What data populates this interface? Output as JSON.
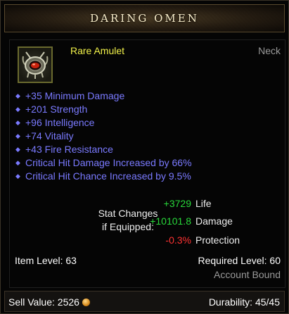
{
  "item": {
    "name": "DARING OMEN",
    "type": "Rare Amulet",
    "slot": "Neck"
  },
  "affixes": [
    "+35 Minimum Damage",
    "+201 Strength",
    "+96 Intelligence",
    "+74 Vitality",
    "+43 Fire Resistance",
    "Critical Hit Damage Increased by 66%",
    "Critical Hit Chance Increased by 9.5%"
  ],
  "stat_changes": {
    "label_line1": "Stat Changes",
    "label_line2": "if Equipped:",
    "rows": [
      {
        "value": "+3729",
        "name": "Life",
        "color": "#28d83a"
      },
      {
        "value": "+10101.8",
        "name": "Damage",
        "color": "#28d83a"
      },
      {
        "value": "-0.3%",
        "name": "Protection",
        "color": "#ff3232"
      }
    ]
  },
  "levels": {
    "item_level": "Item Level: 63",
    "required_level": "Required Level: 60",
    "binding": "Account Bound"
  },
  "footer": {
    "sell_label": "Sell Value:",
    "sell_value": "2526",
    "durability_label": "Durability:",
    "durability_value": "45/45"
  },
  "colors": {
    "rare": "#f2f24a",
    "affix": "#7a7aff",
    "gain": "#28d83a",
    "loss": "#ff3232"
  },
  "icons": {
    "portrait": "amulet-icon",
    "currency": "gold-coin-icon"
  }
}
